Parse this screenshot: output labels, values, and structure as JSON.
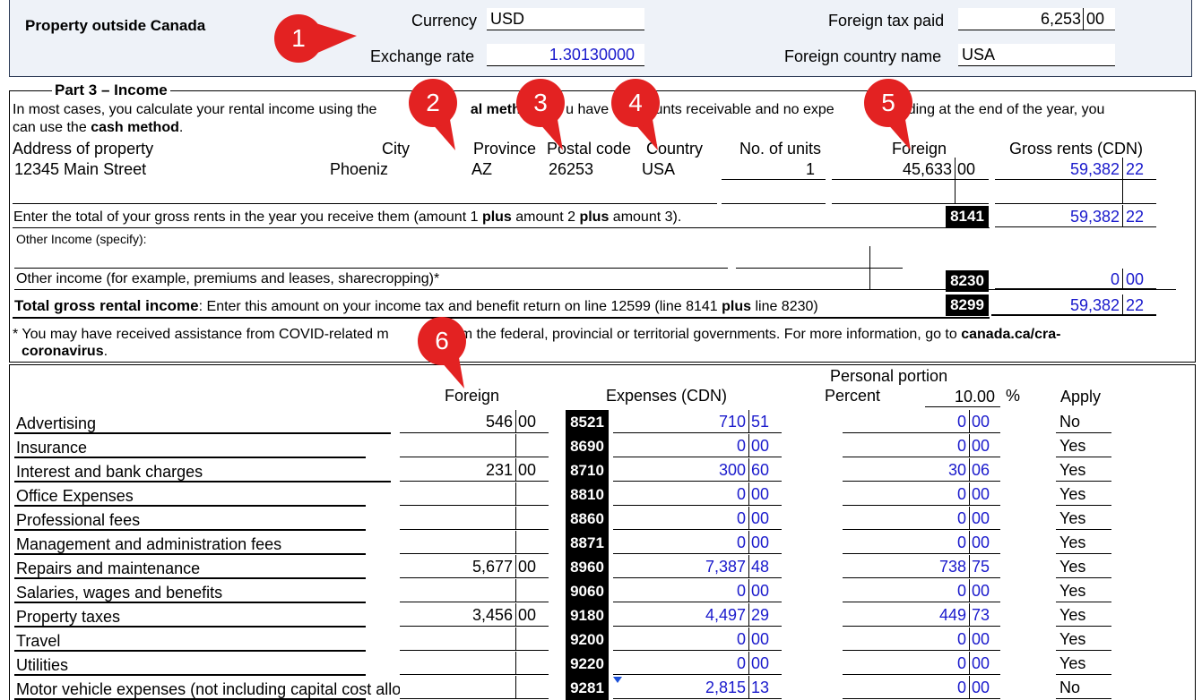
{
  "header": {
    "title": "Property outside Canada",
    "currency_label": "Currency",
    "currency_value": "USD",
    "exchange_label": "Exchange rate",
    "exchange_value": "1.30130000",
    "foreign_tax_label": "Foreign tax paid",
    "foreign_tax_dollars": "6,253",
    "foreign_tax_cents": "00",
    "country_name_label": "Foreign country name",
    "country_name_value": "USA"
  },
  "markers": [
    "1",
    "2",
    "3",
    "4",
    "5",
    "6"
  ],
  "part3": {
    "title": "Part 3 – Income",
    "intro_a": "In most cases, you calculate your rental income using the",
    "intro_bold1": "al metho",
    "intro_b": "u have",
    "intro_c": "ounts receivable and no expe",
    "intro_d": "utstanding at the end of the year, you",
    "intro_e": "can use the",
    "intro_bold2": "cash method",
    "intro_f": ".",
    "col_address": "Address of property",
    "col_city": "City",
    "col_province": "Province",
    "col_postal": "Postal code",
    "col_country": "Country",
    "col_units": "No. of units",
    "col_foreign": "Foreign",
    "col_gross": "Gross rents (CDN)",
    "row": {
      "address": "12345 Main Street",
      "city": "Phoeniz",
      "province": "AZ",
      "postal": "26253",
      "country": "USA",
      "units": "1",
      "foreign_dollars": "45,633",
      "foreign_cents": "00",
      "gross_dollars": "59,382",
      "gross_cents": "22"
    },
    "total_line_a": "Enter the total of your gross rents in the year you receive them (amount 1",
    "total_line_plus": "plus",
    "total_line_b": "amount 2",
    "total_line_c": "amount 3).",
    "code_8141": "8141",
    "total_dollars": "59,382",
    "total_cents": "22",
    "other_income_specify": "Other Income (specify):",
    "other_income_line": "Other income (for example, premiums and leases, sharecropping)*",
    "code_8230": "8230",
    "other_dollars": "0",
    "other_cents": "00",
    "gross_label_bold": "Total gross rental income",
    "gross_label_rest": ": Enter this amount on your income tax and benefit return on line 12599 (line 8141",
    "gross_label_plus": "plus",
    "gross_label_end": "line 8230)",
    "code_8299": "8299",
    "gross_total_dollars": "59,382",
    "gross_total_cents": "22",
    "footnote_a": "* You may have received assistance from COVID-related m",
    "footnote_b": "es from the federal, provincial or territorial governments. For more information, go to",
    "footnote_link1": "canada.ca/cra-",
    "footnote_link2": "coronavirus",
    "footnote_end": "."
  },
  "expenses": {
    "col_foreign": "Foreign",
    "col_expenses": "Expenses (CDN)",
    "personal_portion": "Personal portion",
    "percent_label": "Percent",
    "percent_value": "10.00",
    "percent_sign": "%",
    "apply_label": "Apply",
    "rows": [
      {
        "label": "Advertising",
        "fd": "546",
        "fc": "00",
        "code": "8521",
        "ed": "710",
        "ec": "51",
        "pd": "0",
        "pc": "00",
        "apply": "No"
      },
      {
        "label": "Insurance",
        "fd": "",
        "fc": "",
        "code": "8690",
        "ed": "0",
        "ec": "00",
        "pd": "0",
        "pc": "00",
        "apply": "Yes"
      },
      {
        "label": "Interest and bank charges",
        "fd": "231",
        "fc": "00",
        "code": "8710",
        "ed": "300",
        "ec": "60",
        "pd": "30",
        "pc": "06",
        "apply": "Yes"
      },
      {
        "label": "Office Expenses",
        "fd": "",
        "fc": "",
        "code": "8810",
        "ed": "0",
        "ec": "00",
        "pd": "0",
        "pc": "00",
        "apply": "Yes"
      },
      {
        "label": "Professional fees",
        "fd": "",
        "fc": "",
        "code": "8860",
        "ed": "0",
        "ec": "00",
        "pd": "0",
        "pc": "00",
        "apply": "Yes"
      },
      {
        "label": "Management and administration fees",
        "fd": "",
        "fc": "",
        "code": "8871",
        "ed": "0",
        "ec": "00",
        "pd": "0",
        "pc": "00",
        "apply": "Yes"
      },
      {
        "label": "Repairs and maintenance",
        "fd": "5,677",
        "fc": "00",
        "code": "8960",
        "ed": "7,387",
        "ec": "48",
        "pd": "738",
        "pc": "75",
        "apply": "Yes"
      },
      {
        "label": "Salaries, wages and benefits",
        "fd": "",
        "fc": "",
        "code": "9060",
        "ed": "0",
        "ec": "00",
        "pd": "0",
        "pc": "00",
        "apply": "Yes"
      },
      {
        "label": "Property taxes",
        "fd": "3,456",
        "fc": "00",
        "code": "9180",
        "ed": "4,497",
        "ec": "29",
        "pd": "449",
        "pc": "73",
        "apply": "Yes"
      },
      {
        "label": "Travel",
        "fd": "",
        "fc": "",
        "code": "9200",
        "ed": "0",
        "ec": "00",
        "pd": "0",
        "pc": "00",
        "apply": "Yes"
      },
      {
        "label": "Utilities",
        "fd": "",
        "fc": "",
        "code": "9220",
        "ed": "0",
        "ec": "00",
        "pd": "0",
        "pc": "00",
        "apply": "Yes"
      },
      {
        "label": "Motor vehicle expenses (not including capital cost allowance)",
        "fd": "",
        "fc": "",
        "code": "9281",
        "ed": "2,815",
        "ec": "13",
        "pd": "0",
        "pc": "00",
        "apply": "No"
      }
    ]
  }
}
